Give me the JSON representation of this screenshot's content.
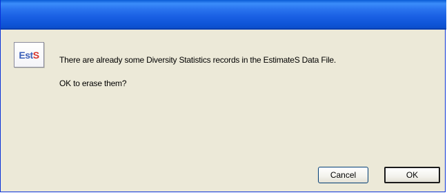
{
  "window": {
    "title": ""
  },
  "icon": {
    "name": "estimates-app-icon",
    "text_part_a": "Est",
    "text_part_b": "S",
    "color_a": "#3a5fb8",
    "color_b": "#d8342c"
  },
  "message": {
    "line1": "There are already some Diversity Statistics records in the EstimateS Data File.",
    "line2": "OK to erase them?"
  },
  "buttons": {
    "cancel_label": "Cancel",
    "ok_label": "OK"
  },
  "colors": {
    "titlebar": "#0a5bd6",
    "dialog_background": "#ece9d8"
  }
}
